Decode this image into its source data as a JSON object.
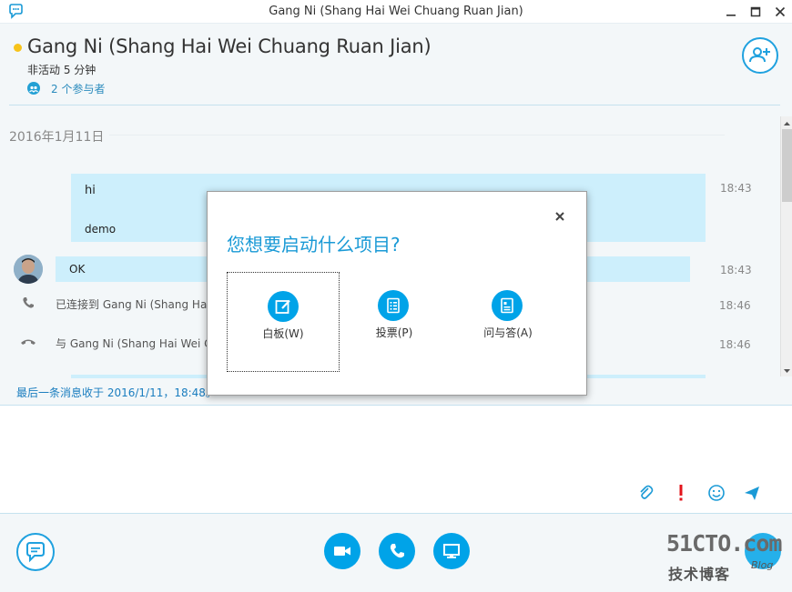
{
  "window": {
    "title": "Gang Ni (Shang Hai Wei Chuang Ruan Jian)",
    "app_icon": "skype-chat-icon"
  },
  "header": {
    "contact_name": "Gang Ni (Shang Hai Wei Chuang Ruan Jian)",
    "status": "非活动 5 分钟",
    "participants": "2 个参与者",
    "presence_color": "#f7c31b"
  },
  "conversation": {
    "date": "2016年1月11日",
    "messages": [
      {
        "text": "hi",
        "time": "18:43"
      },
      {
        "text": "demo",
        "time": ""
      },
      {
        "text": "OK",
        "time": "18:43"
      }
    ],
    "system": [
      {
        "icon": "phone-icon",
        "text": "已连接到 Gang Ni (Shang Hai",
        "time": "18:46"
      },
      {
        "icon": "hangup-icon",
        "text": "与 Gang Ni (Shang Hai Wei C",
        "time": "18:46"
      }
    ],
    "last_message": "最后一条消息收于 2016/1/11，18:48。"
  },
  "dialog": {
    "title": "您想要启动什么项目?",
    "options": [
      {
        "label": "白板(W)",
        "icon": "whiteboard-icon"
      },
      {
        "label": "投票(P)",
        "icon": "poll-icon"
      },
      {
        "label": "问与答(A)",
        "icon": "qa-icon"
      }
    ]
  },
  "watermark": {
    "site": "51CTO.com",
    "subtitle": "技术博客",
    "blog": "Blog"
  },
  "colors": {
    "accent": "#00a3e8",
    "bubble": "#cdeffc",
    "link": "#1a7dbf"
  }
}
